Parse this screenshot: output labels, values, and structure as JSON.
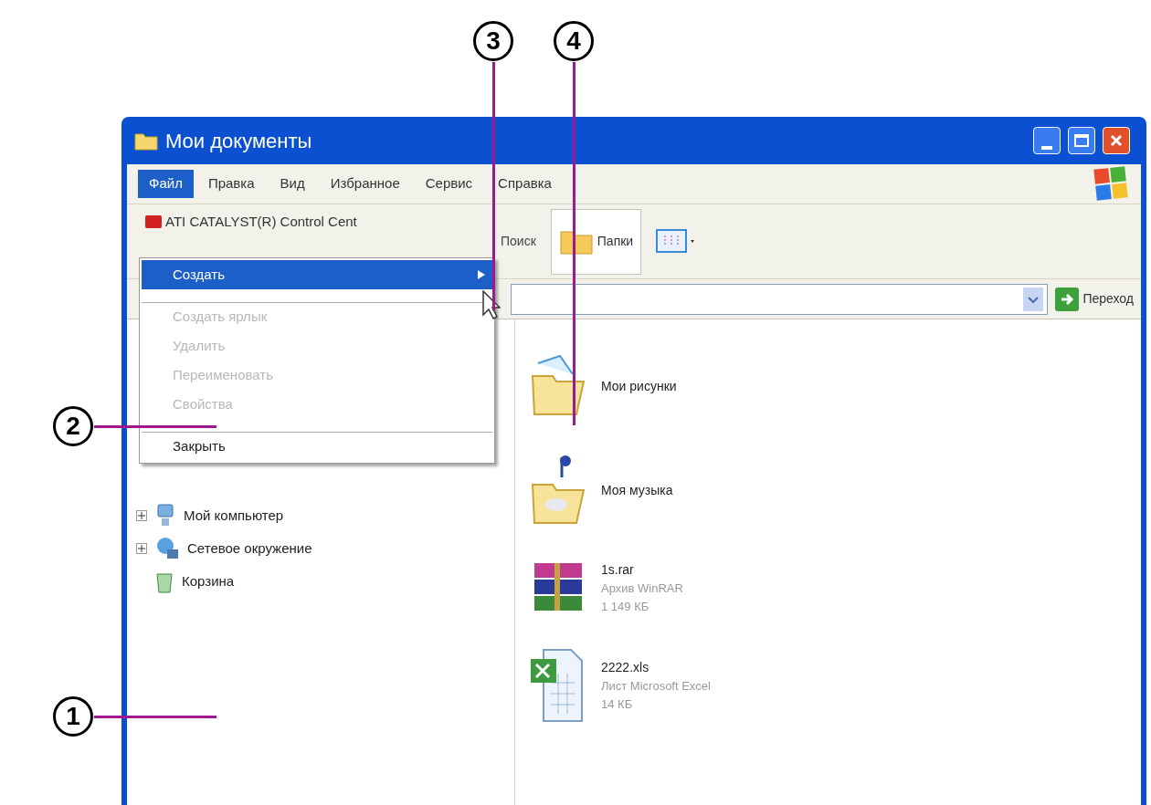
{
  "window": {
    "title": "Мои документы"
  },
  "menu_bar": [
    {
      "label": "Файл",
      "selected": true
    },
    {
      "label": "Правка",
      "selected": false
    },
    {
      "label": "Вид",
      "selected": false
    },
    {
      "label": "Избранное",
      "selected": false
    },
    {
      "label": "Сервис",
      "selected": false
    },
    {
      "label": "Справка",
      "selected": false
    }
  ],
  "toolbar": {
    "app_item": "ATI CATALYST(R) Control Cent",
    "search": "Поиск",
    "folders": {
      "label": "Папки",
      "selected": true
    }
  },
  "address_bar": {
    "go_button": "Переход"
  },
  "file_menu": [
    {
      "label": "Создать",
      "selected": true,
      "disabled": false,
      "submenu": true,
      "separator_before": false
    },
    {
      "label": "Создать ярлык",
      "selected": false,
      "disabled": true,
      "submenu": false,
      "separator_before": true
    },
    {
      "label": "Удалить",
      "selected": false,
      "disabled": true,
      "submenu": false,
      "separator_before": false
    },
    {
      "label": "Переименовать",
      "selected": false,
      "disabled": true,
      "submenu": false,
      "separator_before": false
    },
    {
      "label": "Свойства",
      "selected": false,
      "disabled": true,
      "submenu": false,
      "separator_before": false
    },
    {
      "label": "Закрыть",
      "selected": false,
      "disabled": false,
      "submenu": false,
      "separator_before": true
    }
  ],
  "tree": [
    {
      "label": "Мой компьютер",
      "kind": "computer",
      "expandable": true
    },
    {
      "label": "Сетевое окружение",
      "kind": "network",
      "expandable": true
    },
    {
      "label": "Корзина",
      "kind": "recycle",
      "expandable": false
    }
  ],
  "files": [
    {
      "kind": "folder-pictures",
      "name": "Мои рисунки"
    },
    {
      "kind": "folder-music",
      "name": "Моя музыка"
    },
    {
      "kind": "archive",
      "name": "1s.rar",
      "type": "Архив WinRAR",
      "size": "1 149 КБ"
    },
    {
      "kind": "excel",
      "name": "2222.xls",
      "type": "Лист Microsoft Excel",
      "size": "14 КБ"
    }
  ],
  "callouts": [
    {
      "label": "3"
    },
    {
      "label": "4"
    },
    {
      "label": "2"
    },
    {
      "label": "1"
    }
  ]
}
